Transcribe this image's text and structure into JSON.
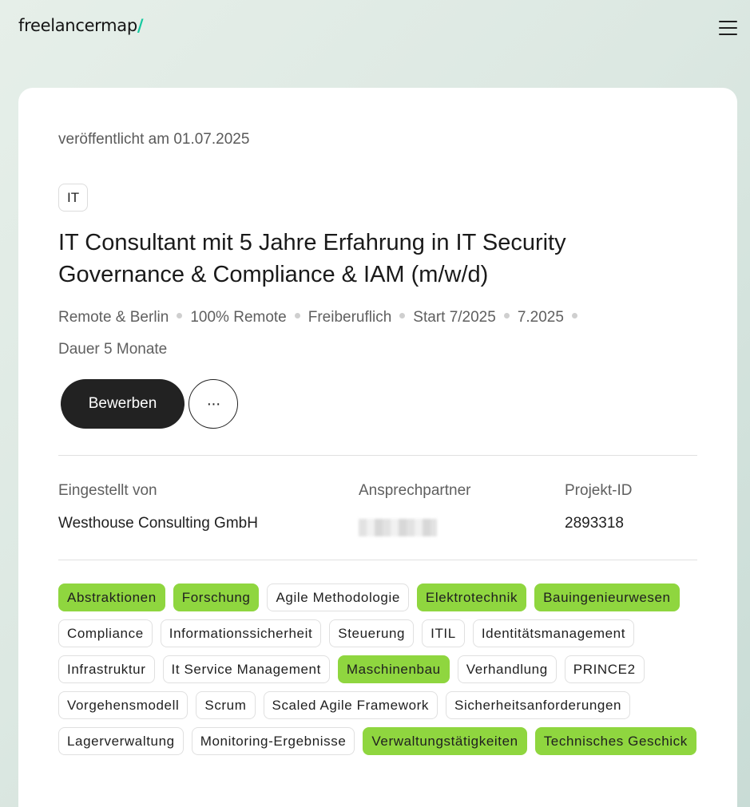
{
  "header": {
    "logo_text": "freelancermap",
    "logo_slash": "/",
    "accent_color": "#16c9a0"
  },
  "project": {
    "published": "veröffentlicht am 01.07.2025",
    "category": "IT",
    "title": "IT Consultant mit 5 Jahre Erfahrung in IT Security Governance & Compliance & IAM (m/w/d)",
    "meta": [
      "Remote & Berlin",
      "100% Remote",
      "Freiberuflich",
      "Start 7/2025",
      "7.2025",
      "Dauer 5 Monate"
    ],
    "apply_label": "Bewerben",
    "more_label": "···"
  },
  "info": {
    "posted_by_label": "Eingestellt von",
    "posted_by_value": "Westhouse Consulting GmbH",
    "contact_label": "Ansprechpartner",
    "project_id_label": "Projekt-ID",
    "project_id_value": "2893318"
  },
  "tags": [
    {
      "label": "Abstraktionen",
      "highlighted": true
    },
    {
      "label": "Forschung",
      "highlighted": true
    },
    {
      "label": "Agile Methodologie",
      "highlighted": false
    },
    {
      "label": "Elektrotechnik",
      "highlighted": true
    },
    {
      "label": "Bauingenieurwesen",
      "highlighted": true
    },
    {
      "label": "Compliance",
      "highlighted": false
    },
    {
      "label": "Informationssicherheit",
      "highlighted": false
    },
    {
      "label": "Steuerung",
      "highlighted": false
    },
    {
      "label": "ITIL",
      "highlighted": false
    },
    {
      "label": "Identitätsmanagement",
      "highlighted": false
    },
    {
      "label": "Infrastruktur",
      "highlighted": false
    },
    {
      "label": "It Service Management",
      "highlighted": false
    },
    {
      "label": "Maschinenbau",
      "highlighted": true
    },
    {
      "label": "Verhandlung",
      "highlighted": false
    },
    {
      "label": "PRINCE2",
      "highlighted": false
    },
    {
      "label": "Vorgehensmodell",
      "highlighted": false
    },
    {
      "label": "Scrum",
      "highlighted": false
    },
    {
      "label": "Scaled Agile Framework",
      "highlighted": false
    },
    {
      "label": "Sicherheitsanforderungen",
      "highlighted": false
    },
    {
      "label": "Lagerverwaltung",
      "highlighted": false
    },
    {
      "label": "Monitoring-Ergebnisse",
      "highlighted": false
    },
    {
      "label": "Verwaltungstätigkeiten",
      "highlighted": true
    },
    {
      "label": "Technisches Geschick",
      "highlighted": true
    }
  ],
  "colors": {
    "highlight": "#8fd63f",
    "button_dark": "#222222"
  }
}
